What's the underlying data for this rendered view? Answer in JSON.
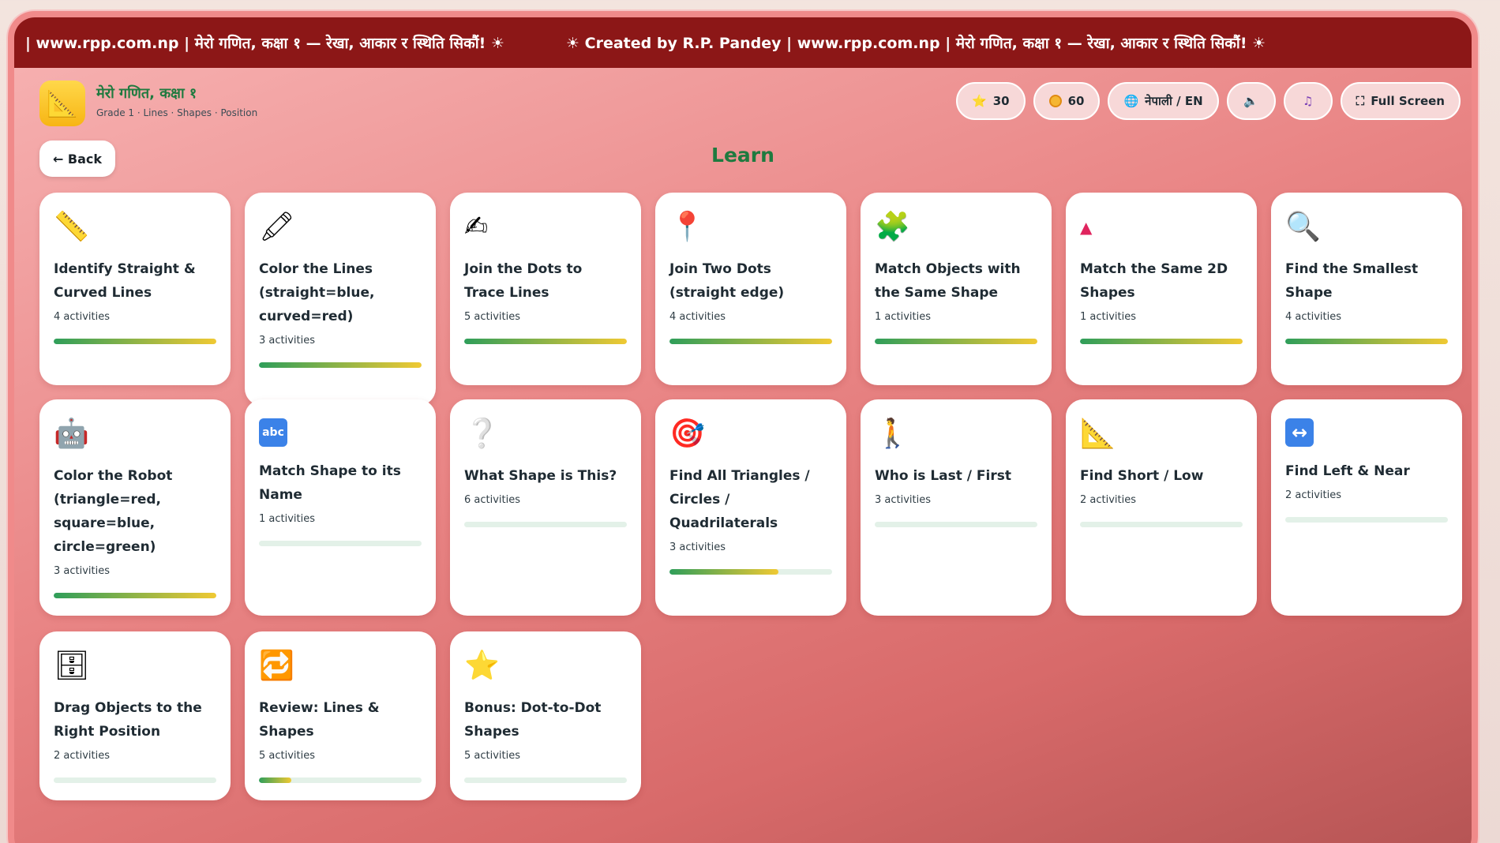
{
  "ticker": {
    "items": [
      "| www.rpp.com.np | मेरो गणित, कक्षा १ — रेखा, आकार र स्थिति सिकौं! ☀",
      "☀ Created by R.P. Pandey | www.rpp.com.np | मेरो गणित, कक्षा १ — रेखा, आकार र स्थिति सिकौं! ☀"
    ]
  },
  "header": {
    "title": "मेरो गणित, कक्षा १",
    "subtitle": "Grade 1 · Lines · Shapes · Position",
    "stars": "30",
    "coins": "60",
    "language": "नेपाली / EN",
    "fullscreen": "Full Screen"
  },
  "back_label": "← Back",
  "page_title": "Learn",
  "cards": [
    {
      "icon": "📏",
      "title": "Identify Straight & Curved Lines",
      "count": "4 activities",
      "progress": 1.0
    },
    {
      "icon": "🖍",
      "title": "Color the Lines (straight=blue, curved=red)",
      "count": "3 activities",
      "progress": 1.0
    },
    {
      "icon": "✍",
      "title": "Join the Dots to Trace Lines",
      "count": "5 activities",
      "progress": 1.0
    },
    {
      "icon": "📍",
      "title": "Join Two Dots (straight edge)",
      "count": "4 activities",
      "progress": 1.0
    },
    {
      "icon": "🧩",
      "title": "Match Objects with the Same Shape",
      "count": "1 activities",
      "progress": 1.0
    },
    {
      "icon": "▲",
      "title": "Match the Same 2D Shapes",
      "count": "1 activities",
      "progress": 1.0
    },
    {
      "icon": "🔍",
      "title": "Find the Smallest Shape",
      "count": "4 activities",
      "progress": 1.0
    },
    {
      "icon": "🤖",
      "title": "Color the Robot (triangle=red, square=blue, circle=green)",
      "count": "3 activities",
      "progress": 1.0
    },
    {
      "icon": "abc",
      "title": "Match Shape to its Name",
      "count": "1 activities",
      "progress": 0.0
    },
    {
      "icon": "❔",
      "title": "What Shape is This?",
      "count": "6 activities",
      "progress": 0.0
    },
    {
      "icon": "🎯",
      "title": "Find All Triangles / Circles / Quadrilaterals",
      "count": "3 activities",
      "progress": 0.67
    },
    {
      "icon": "🚶",
      "title": "Who is Last / First",
      "count": "3 activities",
      "progress": 0.0
    },
    {
      "icon": "📐",
      "title": "Find Short / Low",
      "count": "2 activities",
      "progress": 0.0
    },
    {
      "icon": "↔",
      "title": "Find Left & Near",
      "count": "2 activities",
      "progress": 0.0
    },
    {
      "icon": "🗄",
      "title": "Drag Objects to the Right Position",
      "count": "2 activities",
      "progress": 0.0
    },
    {
      "icon": "🔁",
      "title": "Review: Lines & Shapes",
      "count": "5 activities",
      "progress": 0.2
    },
    {
      "icon": "⭐",
      "title": "Bonus: Dot-to-Dot Shapes",
      "count": "5 activities",
      "progress": 0.0
    }
  ]
}
